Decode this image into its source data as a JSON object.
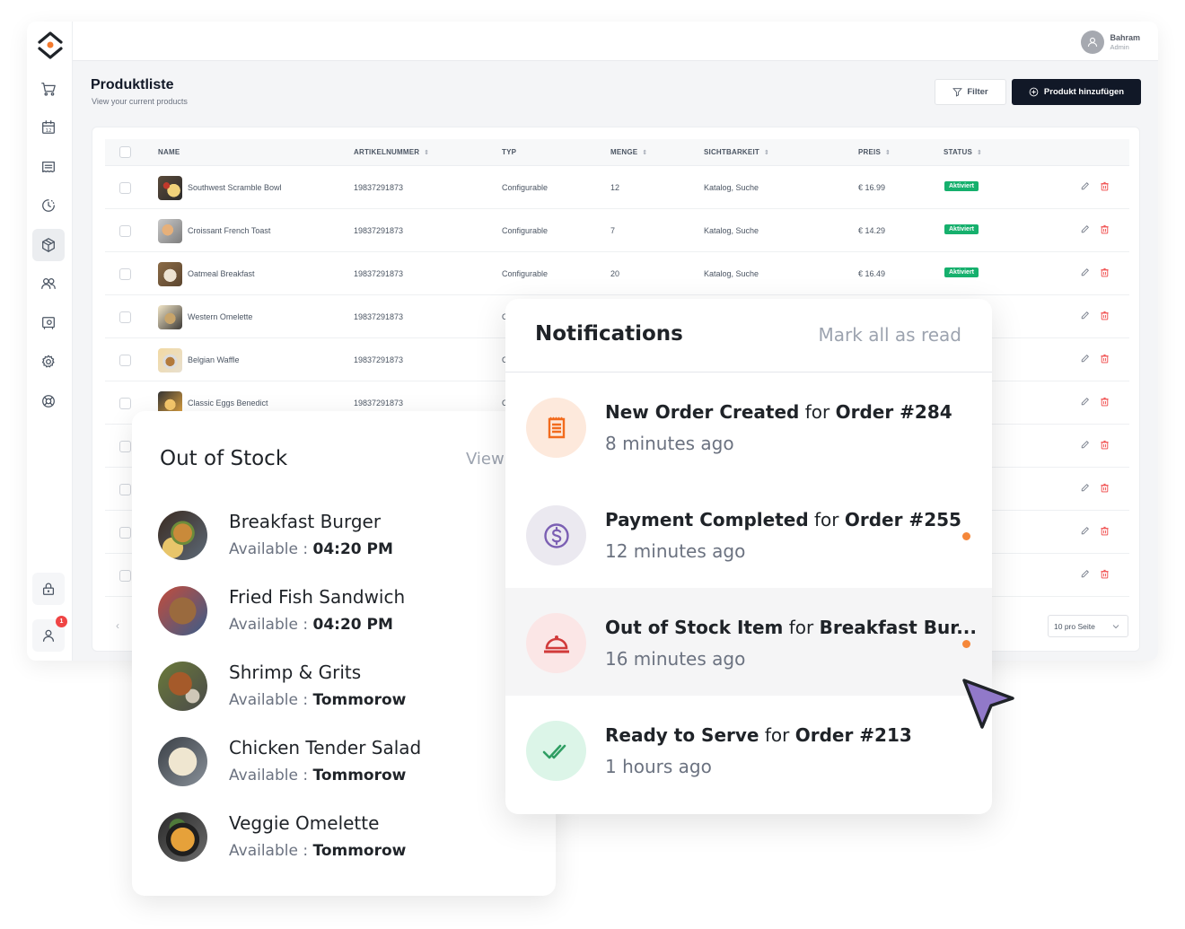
{
  "user": {
    "name": "Bahram",
    "role": "Admin"
  },
  "page": {
    "title": "Produktliste",
    "subtitle": "View your current products"
  },
  "toolbar": {
    "filter_label": "Filter",
    "add_label": "Produkt hinzufügen"
  },
  "sidebar": {
    "items": [
      {
        "icon": "cart-icon"
      },
      {
        "icon": "calendar-icon",
        "text": "12"
      },
      {
        "icon": "receipt-icon"
      },
      {
        "icon": "clock-icon"
      },
      {
        "icon": "box-icon",
        "active": true
      },
      {
        "icon": "users-icon"
      },
      {
        "icon": "safe-icon"
      },
      {
        "icon": "gear-icon"
      },
      {
        "icon": "lifebuoy-icon"
      }
    ],
    "bottom": [
      {
        "icon": "lock-icon"
      },
      {
        "icon": "user-icon",
        "badge": "1"
      }
    ]
  },
  "table": {
    "columns": [
      "NAME",
      "ARTIKELNUMMER",
      "TYP",
      "MENGE",
      "SICHTBARKEIT",
      "PREIS",
      "STATUS"
    ],
    "sortable": [
      false,
      true,
      false,
      true,
      true,
      true,
      true
    ],
    "rows": [
      {
        "name": "Southwest Scramble Bowl",
        "sku": "19837291873",
        "type": "Configurable",
        "qty": "12",
        "visibility": "Katalog, Suche",
        "price": "€ 16.99",
        "status": "Aktiviert"
      },
      {
        "name": "Croissant French Toast",
        "sku": "19837291873",
        "type": "Configurable",
        "qty": "7",
        "visibility": "Katalog, Suche",
        "price": "€ 14.29",
        "status": "Aktiviert"
      },
      {
        "name": "Oatmeal Breakfast",
        "sku": "19837291873",
        "type": "Configurable",
        "qty": "20",
        "visibility": "Katalog, Suche",
        "price": "€ 16.49",
        "status": "Aktiviert"
      },
      {
        "name": "Western Omelette",
        "sku": "19837291873",
        "type": "C"
      },
      {
        "name": "Belgian Waffle",
        "sku": "19837291873",
        "type": "C"
      },
      {
        "name": "Classic Eggs Benedict",
        "sku": "19837291873",
        "type": "C"
      },
      {},
      {},
      {},
      {}
    ],
    "per_page": "10 pro Seite"
  },
  "out_of_stock": {
    "title": "Out of Stock",
    "view_label": "View",
    "available_label": "Available : ",
    "items": [
      {
        "name": "Breakfast Burger",
        "available": "04:20 PM"
      },
      {
        "name": "Fried Fish Sandwich",
        "available": "04:20 PM"
      },
      {
        "name": "Shrimp & Grits",
        "available": "Tommorow"
      },
      {
        "name": "Chicken Tender Salad",
        "available": "Tommorow"
      },
      {
        "name": "Veggie Omelette",
        "available": "Tommorow"
      }
    ]
  },
  "notifications": {
    "title": "Notifications",
    "mark_all": "Mark all as read",
    "items": [
      {
        "event": "New Order Created",
        "for": " for ",
        "target": "Order #284",
        "time": "8 minutes ago",
        "icon": "receipt-icon",
        "unread": false,
        "color": "#f26b1d",
        "bg": "#fde9dc"
      },
      {
        "event": "Payment Completed",
        "for": " for ",
        "target": "Order #255",
        "time": "12 minutes ago",
        "icon": "dollar-icon",
        "unread": true,
        "color": "#7b5fb3",
        "bg": "#ebe9f0"
      },
      {
        "event": "Out of Stock Item",
        "for": " for ",
        "target": "Breakfast Bur...",
        "time": "16 minutes ago",
        "icon": "cloche-icon",
        "unread": true,
        "color": "#d13b3b",
        "bg": "#fbe6e6"
      },
      {
        "event": "Ready to Serve",
        "for": " for ",
        "target": "Order #213",
        "time": "1 hours ago",
        "icon": "double-check-icon",
        "unread": false,
        "color": "#2f9e63",
        "bg": "#dcf5e8"
      }
    ]
  },
  "colors": {
    "accent": "#111827",
    "status_green": "#16b06d",
    "unread_dot": "#f5873a",
    "cursor": "#9179c9"
  }
}
